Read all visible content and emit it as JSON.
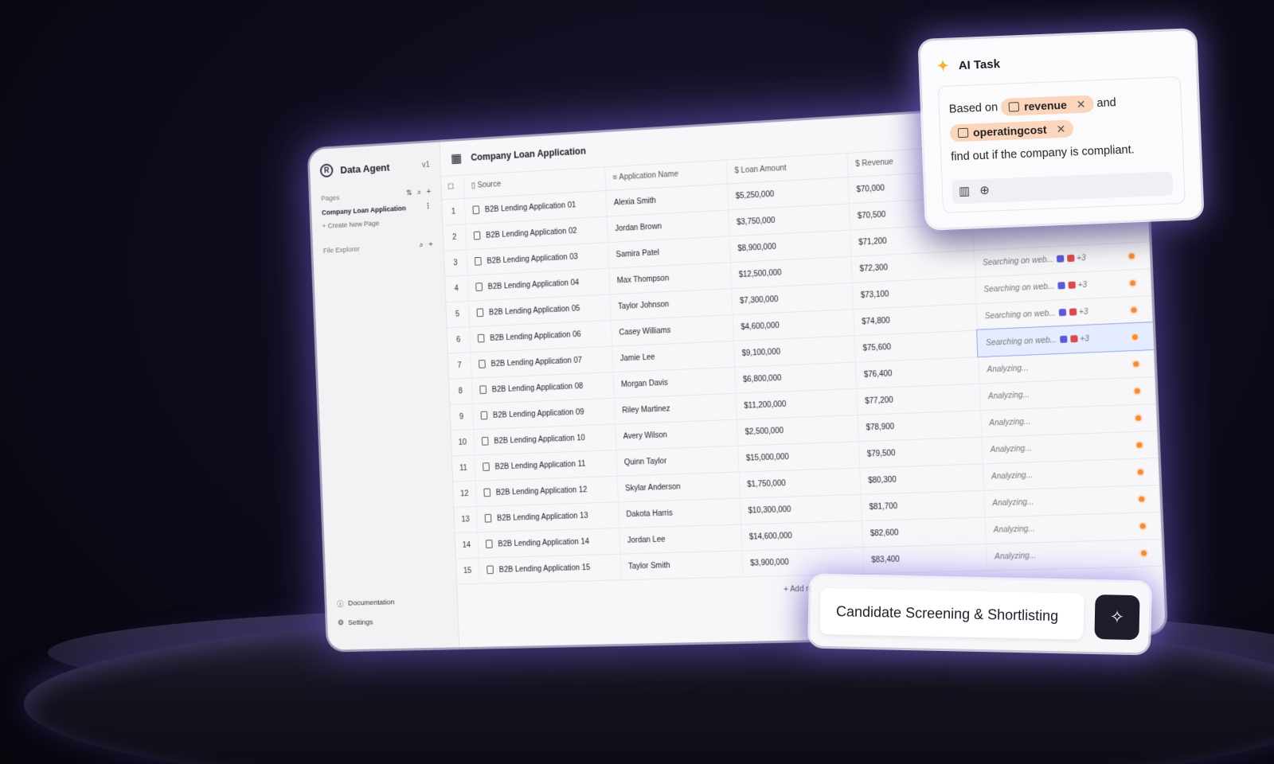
{
  "sidebar": {
    "brand": "Data Agent",
    "version": "v1",
    "pages_label": "Pages",
    "current_page": "Company Loan Application",
    "create_page": "Create New Page",
    "file_explorer": "File Explorer",
    "documentation": "Documentation",
    "settings": "Settings"
  },
  "table": {
    "title": "Company Loan Application",
    "columns": {
      "source": "Source",
      "name": "Application Name",
      "amount": "Loan Amount",
      "revenue": "Revenue"
    },
    "rows": [
      {
        "n": "1",
        "source": "B2B Lending Application 01",
        "name": "Alexia Smith",
        "amount": "$5,250,000",
        "revenue": "$70,000",
        "status": ""
      },
      {
        "n": "2",
        "source": "B2B Lending Application 02",
        "name": "Jordan Brown",
        "amount": "$3,750,000",
        "revenue": "$70,500",
        "status": ""
      },
      {
        "n": "3",
        "source": "B2B Lending Application 03",
        "name": "Samira Patel",
        "amount": "$8,900,000",
        "revenue": "$71,200",
        "status": ""
      },
      {
        "n": "4",
        "source": "B2B Lending Application 04",
        "name": "Max Thompson",
        "amount": "$12,500,000",
        "revenue": "$72,300",
        "status": "Searching on web...",
        "extra": "+3"
      },
      {
        "n": "5",
        "source": "B2B Lending Application 05",
        "name": "Taylor Johnson",
        "amount": "$7,300,000",
        "revenue": "$73,100",
        "status": "Searching on web...",
        "extra": "+3"
      },
      {
        "n": "6",
        "source": "B2B Lending Application 06",
        "name": "Casey Williams",
        "amount": "$4,600,000",
        "revenue": "$74,800",
        "status": "Searching on web...",
        "extra": "+3"
      },
      {
        "n": "7",
        "source": "B2B Lending Application 07",
        "name": "Jamie Lee",
        "amount": "$9,100,000",
        "revenue": "$75,600",
        "status": "Searching on web...",
        "extra": "+3"
      },
      {
        "n": "8",
        "source": "B2B Lending Application 08",
        "name": "Morgan Davis",
        "amount": "$6,800,000",
        "revenue": "$76,400",
        "status": "Analyzing..."
      },
      {
        "n": "9",
        "source": "B2B Lending Application 09",
        "name": "Riley Martinez",
        "amount": "$11,200,000",
        "revenue": "$77,200",
        "status": "Analyzing..."
      },
      {
        "n": "10",
        "source": "B2B Lending Application 10",
        "name": "Avery Wilson",
        "amount": "$2,500,000",
        "revenue": "$78,900",
        "status": "Analyzing..."
      },
      {
        "n": "11",
        "source": "B2B Lending Application 11",
        "name": "Quinn Taylor",
        "amount": "$15,000,000",
        "revenue": "$79,500",
        "status": "Analyzing..."
      },
      {
        "n": "12",
        "source": "B2B Lending Application 12",
        "name": "Skylar Anderson",
        "amount": "$1,750,000",
        "revenue": "$80,300",
        "status": "Analyzing..."
      },
      {
        "n": "13",
        "source": "B2B Lending Application 13",
        "name": "Dakota Harris",
        "amount": "$10,300,000",
        "revenue": "$81,700",
        "status": "Analyzing..."
      },
      {
        "n": "14",
        "source": "B2B Lending Application 14",
        "name": "Jordan Lee",
        "amount": "$14,600,000",
        "revenue": "$82,600",
        "status": "Analyzing..."
      },
      {
        "n": "15",
        "source": "B2B Lending Application 15",
        "name": "Taylor Smith",
        "amount": "$3,900,000",
        "revenue": "$83,400",
        "status": "Analyzing..."
      }
    ],
    "add_row": "Add row"
  },
  "ai_task": {
    "title": "AI Task",
    "prefix": "Based on",
    "chip1": "revenue",
    "joiner": "and",
    "chip2": "operatingcost",
    "suffix": "find out if the company is compliant."
  },
  "action": {
    "label": "Candidate Screening & Shortlisting"
  },
  "colors": {
    "accent": "#f28c38",
    "chip": "#fbd6bd",
    "glow": "#8c6eff"
  }
}
